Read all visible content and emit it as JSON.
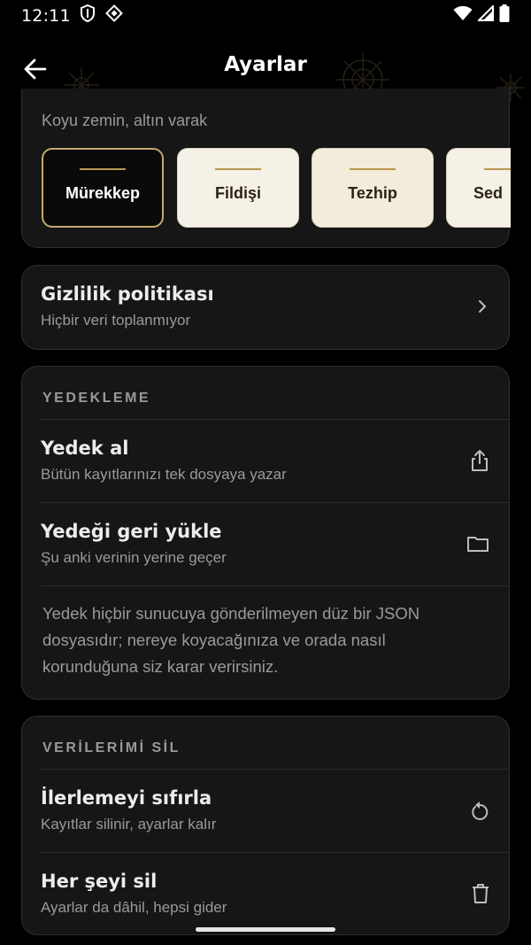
{
  "status_bar": {
    "time": "12:11",
    "icons": [
      "shield-icon",
      "diamond-icon",
      "wifi-icon",
      "signal-icon",
      "battery-icon"
    ]
  },
  "app_bar": {
    "title": "Ayarlar",
    "back_icon": "arrow-left-icon"
  },
  "theme": {
    "subtitle": "Koyu zemin, altın varak",
    "accent_color": "#c6a96e",
    "options": [
      {
        "label": "Mürekkep",
        "selected": true
      },
      {
        "label": "Fildişi",
        "selected": false
      },
      {
        "label": "Tezhip",
        "selected": false
      },
      {
        "label": "Sed",
        "selected": false
      }
    ]
  },
  "privacy": {
    "title": "Gizlilik politikası",
    "subtitle": "Hiçbir veri toplanmıyor",
    "icon": "chevron-right-icon"
  },
  "backup": {
    "section_label": "YEDEKLEME",
    "items": [
      {
        "title": "Yedek al",
        "subtitle": "Bütün kayıtlarınızı tek dosyaya yazar",
        "icon": "share-icon"
      },
      {
        "title": "Yedeği geri yükle",
        "subtitle": "Şu anki verinin yerine geçer",
        "icon": "folder-icon"
      }
    ],
    "note": "Yedek hiçbir sunucuya gönderilmeyen düz bir JSON dosyasıdır; nereye koyacağınıza ve orada nasıl korunduğuna siz karar verirsiniz."
  },
  "delete_data": {
    "section_label": "VERİLERİMİ SİL",
    "items": [
      {
        "title": "İlerlemeyi sıfırla",
        "subtitle": "Kayıtlar silinir, ayarlar kalır",
        "icon": "reset-icon"
      },
      {
        "title": "Her şeyi sil",
        "subtitle": "Ayarlar da dâhil, hepsi gider",
        "icon": "trash-icon"
      }
    ]
  }
}
